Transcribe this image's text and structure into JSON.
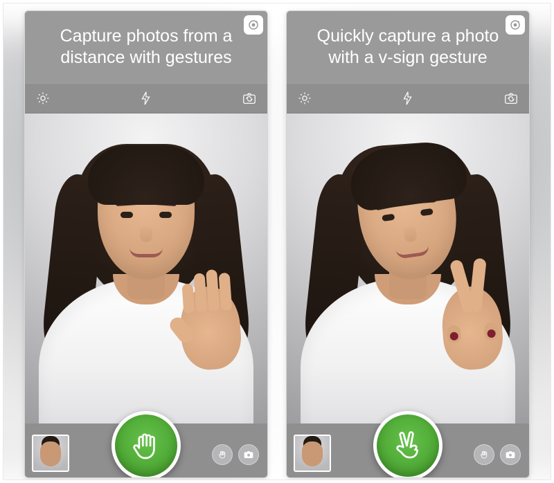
{
  "icons": {
    "settings": "gear-icon",
    "flash": "flash-icon",
    "switch_camera": "switch-camera-icon",
    "app_badge": "app-logo-icon",
    "gesture_mode": "hand-icon",
    "camera_mode": "camera-icon"
  },
  "colors": {
    "shutter_green": "#55b63c",
    "toolbar_grey": "#8f8f90",
    "caption_grey": "#9a9a9b"
  },
  "screens": [
    {
      "id": "left",
      "caption": "Capture photos from a distance with gestures",
      "shutter_gesture": "open-hand",
      "toolbar": {
        "settings": true,
        "flash": true,
        "switch_camera": true
      },
      "controls": {
        "thumbnail": true,
        "gesture_mode_button": true,
        "camera_mode_button": true
      }
    },
    {
      "id": "right",
      "caption": "Quickly capture a photo with a v-sign gesture",
      "shutter_gesture": "v-sign",
      "toolbar": {
        "settings": true,
        "flash": true,
        "switch_camera": true
      },
      "controls": {
        "thumbnail": true,
        "gesture_mode_button": true,
        "camera_mode_button": true
      }
    }
  ]
}
